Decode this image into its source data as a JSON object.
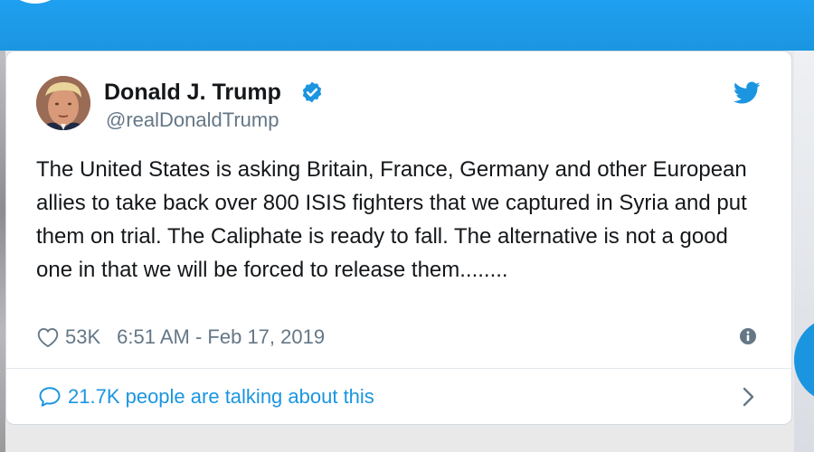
{
  "tweet": {
    "author_name": "Donald J. Trump",
    "handle": "@realDonaldTrump",
    "text": "The United States is asking Britain, France, Germany and other European allies to take back over 800 ISIS fighters that we captured in Syria and put them on trial. The Caliphate is ready to fall. The alternative is not a good one in that we will be forced to release them........",
    "likes": "53K",
    "timestamp": "6:51 AM - Feb 17, 2019",
    "conversation": "21.7K people are talking about this"
  },
  "icons": {
    "verified": "verified-badge-icon",
    "brand": "twitter-bird-icon",
    "like": "heart-icon",
    "info": "info-icon",
    "conversation": "speech-bubble-icon",
    "open": "chevron-right-icon"
  },
  "colors": {
    "twitter_blue": "#1b95e0",
    "text_primary": "#14171a",
    "text_secondary": "#657786",
    "border": "#e1e8ed"
  }
}
